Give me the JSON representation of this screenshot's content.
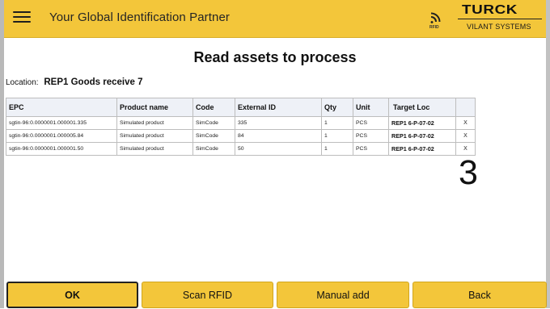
{
  "header": {
    "title": "Your Global Identification Partner",
    "rfid_icon": "rfid-icon",
    "rfid_label": "RFID",
    "logo": "TURCK",
    "logo_sub": "VILANT SYSTEMS"
  },
  "page": {
    "title": "Read assets to process",
    "location_label": "Location:",
    "location_value": "REP1 Goods receive 7",
    "item_count": "3"
  },
  "table": {
    "columns": [
      "EPC",
      "Product name",
      "Code",
      "External ID",
      "Qty",
      "Unit",
      "Target Loc",
      ""
    ],
    "rows": [
      {
        "epc": "sgtin-96:0.0000001.000001.335",
        "product": "Simulated product",
        "code": "SimCode",
        "external_id": "335",
        "qty": "1",
        "unit": "PCS",
        "target": "REP1 6-P-07-02",
        "delete": "X"
      },
      {
        "epc": "sgtin-96:0.0000001.000005.84",
        "product": "Simulated product",
        "code": "SimCode",
        "external_id": "84",
        "qty": "1",
        "unit": "PCS",
        "target": "REP1 6-P-07-02",
        "delete": "X"
      },
      {
        "epc": "sgtin-96:0.0000001.000001.50",
        "product": "Simulated product",
        "code": "SimCode",
        "external_id": "50",
        "qty": "1",
        "unit": "PCS",
        "target": "REP1 6-P-07-02",
        "delete": "X"
      }
    ]
  },
  "footer": {
    "ok": "OK",
    "scan": "Scan RFID",
    "manual": "Manual add",
    "back": "Back"
  },
  "colors": {
    "accent": "#f3c63a",
    "header_bg": "#f3c63a",
    "table_header_bg": "#eef1f7"
  }
}
